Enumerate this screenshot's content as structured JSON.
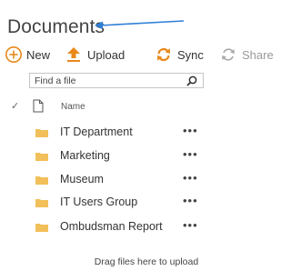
{
  "library": {
    "title": "Documents"
  },
  "toolbar": {
    "new_label": "New",
    "upload_label": "Upload",
    "sync_label": "Sync",
    "share_label": "Share"
  },
  "search": {
    "placeholder": "Find a file"
  },
  "list": {
    "name_header": "Name",
    "items": [
      {
        "name": "IT Department",
        "type": "folder"
      },
      {
        "name": "Marketing",
        "type": "folder"
      },
      {
        "name": "Museum",
        "type": "folder"
      },
      {
        "name": "IT Users Group",
        "type": "folder"
      },
      {
        "name": "Ombudsman Report",
        "type": "folder"
      }
    ],
    "more_label": "•••"
  },
  "drop_hint": "Drag files here to upload",
  "colors": {
    "accent_orange": "#e8891a",
    "annotation_arrow": "#2f7fd8",
    "folder": "#f2c05a",
    "share_disabled": "#9a9a9a"
  },
  "icons": {
    "new": "plus-circle-icon",
    "upload": "upload-arrow-icon",
    "sync": "sync-icon",
    "share": "share-icon",
    "search": "search-icon",
    "header_check": "checkmark-icon",
    "header_doc": "document-icon",
    "folder": "folder-icon",
    "annotation": "annotation-arrow-icon"
  }
}
